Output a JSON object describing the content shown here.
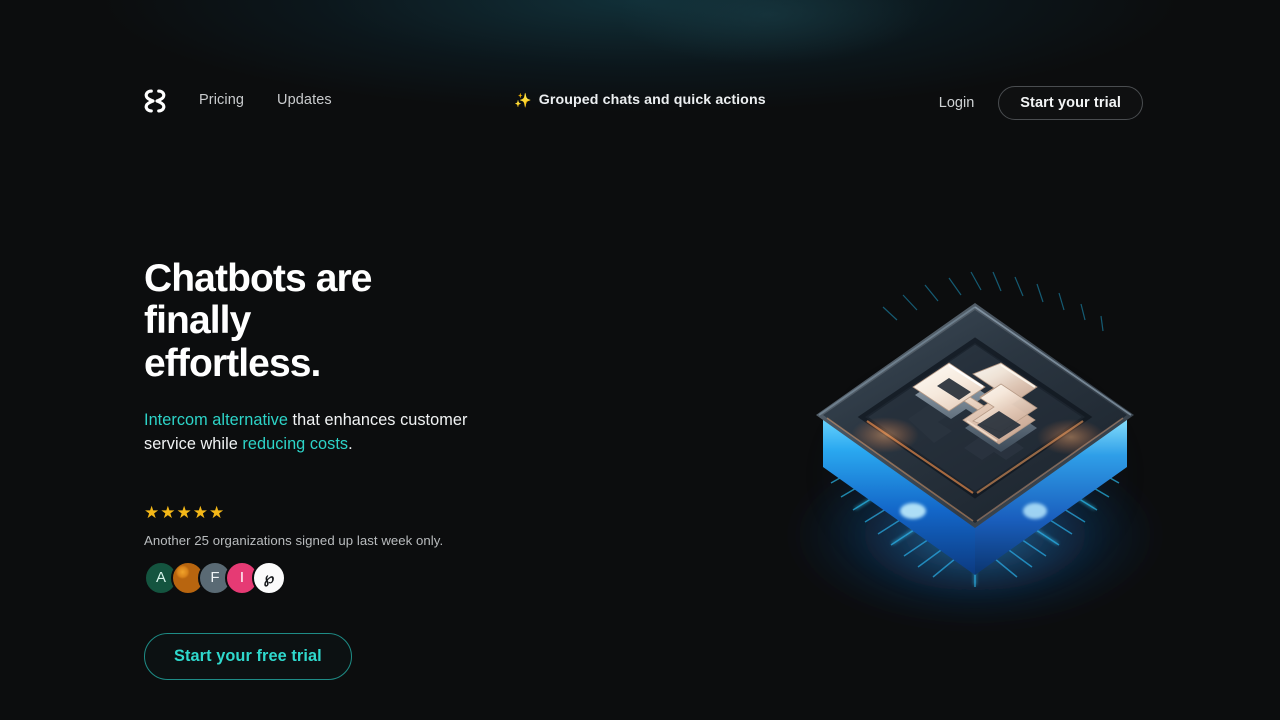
{
  "theme": {
    "background": "#0c0d0e",
    "accent_teal": "#2dd4c8",
    "star_gold": "#f5b818",
    "text_primary": "#ffffff",
    "text_muted": "#b9bcbe",
    "chip_glow_blue": "#1f8ef5"
  },
  "header": {
    "logo_icon": "interlocking-knot-logo",
    "nav_links": [
      {
        "label": "Pricing"
      },
      {
        "label": "Updates"
      }
    ],
    "banner": {
      "icon": "sparkles-icon",
      "icon_glyph": "✨",
      "text": "Grouped chats and quick actions"
    },
    "login_label": "Login",
    "trial_button_label": "Start your trial"
  },
  "hero": {
    "headline_line1": "Chatbots are finally",
    "headline_line2": "effortless.",
    "subhead": {
      "link1": "Intercom alternative",
      "middle": " that enhances customer service while ",
      "link2": "reducing costs",
      "period": "."
    },
    "rating": {
      "stars": 5,
      "star_glyph": "★"
    },
    "signup_note": "Another 25 organizations signed up last week only.",
    "avatars": [
      {
        "name": "avatar-a",
        "type": "initial",
        "label": "A"
      },
      {
        "name": "avatar-photo",
        "type": "photo",
        "label": ""
      },
      {
        "name": "avatar-f",
        "type": "initial",
        "label": "F"
      },
      {
        "name": "avatar-i",
        "type": "initial",
        "label": "I"
      },
      {
        "name": "avatar-monogram",
        "type": "initial",
        "label": "℘"
      }
    ],
    "cta_label": "Start your free trial"
  },
  "graphic": {
    "name": "isometric-3d-chip-with-logo",
    "description": "Dark slate isometric chip with glowing blue side band, cyan circuit traces and an extruded interlocking knot logo on top"
  }
}
